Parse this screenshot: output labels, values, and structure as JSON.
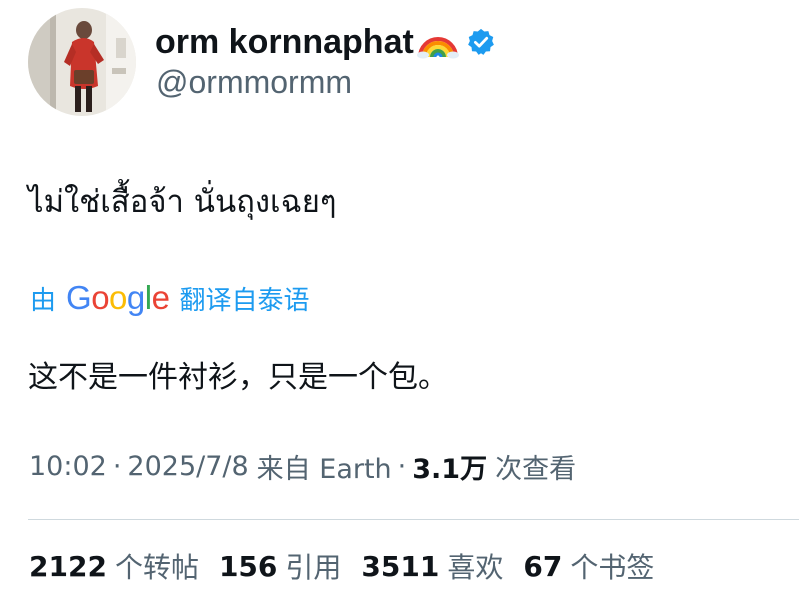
{
  "profile": {
    "display_name": "orm kornnaphat",
    "handle": "@ormmormm",
    "name_emoji_icon": "rainbow-icon",
    "verified_icon": "verified-badge-icon"
  },
  "tweet": {
    "text": "ไม่ใช่เสื้อจ้า นั่นถุงเฉยๆ"
  },
  "translation": {
    "prefix": "由",
    "provider": "Google",
    "suffix": "翻译自泰语",
    "translated_text": "这不是一件衬衫，只是一个包。"
  },
  "meta": {
    "time": "10:02",
    "sep1": "·",
    "date": "2025/7/8",
    "source": "来自 Earth",
    "sep2": "·",
    "views_count": "3.1万",
    "views_label": "次查看"
  },
  "stats": [
    {
      "value": "2122",
      "label": "个转帖"
    },
    {
      "value": "156",
      "label": "引用"
    },
    {
      "value": "3511",
      "label": "喜欢"
    },
    {
      "value": "67",
      "label": "个书签"
    }
  ],
  "colors": {
    "link_blue": "#1d9bf0",
    "secondary_text": "#536471",
    "primary_text": "#0f1419",
    "divider": "#cfd9de",
    "google_blue": "#4285f4",
    "google_red": "#ea4335",
    "google_yellow": "#fbbc05",
    "google_green": "#34a853"
  }
}
